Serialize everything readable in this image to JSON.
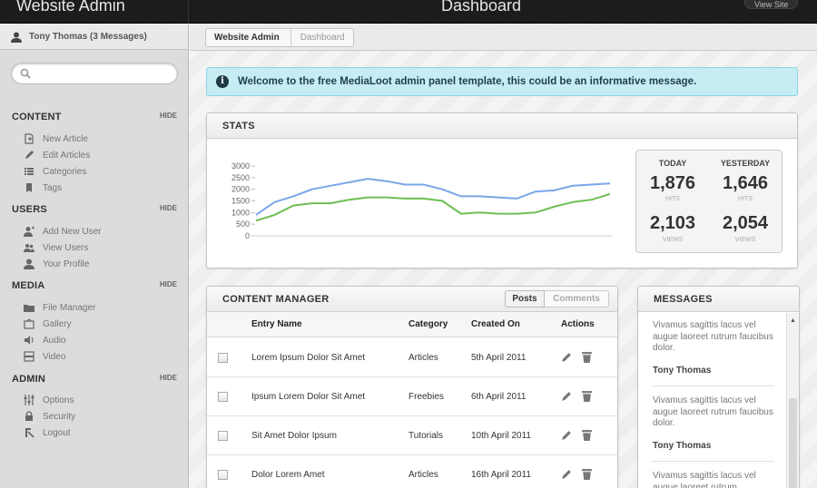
{
  "header": {
    "site_title": "Website Admin",
    "page_title": "Dashboard",
    "view_site": "View Site"
  },
  "user": {
    "label": "Tony Thomas (3 Messages)"
  },
  "search": {
    "placeholder": ""
  },
  "sidebar": {
    "hide_label": "HIDE",
    "sections": [
      {
        "title": "CONTENT",
        "items": [
          {
            "label": "New Article",
            "icon": "new-article-icon"
          },
          {
            "label": "Edit Articles",
            "icon": "pencil-icon"
          },
          {
            "label": "Categories",
            "icon": "list-icon"
          },
          {
            "label": "Tags",
            "icon": "tag-icon"
          }
        ]
      },
      {
        "title": "USERS",
        "items": [
          {
            "label": "Add New User",
            "icon": "add-user-icon"
          },
          {
            "label": "View Users",
            "icon": "users-icon"
          },
          {
            "label": "Your Profile",
            "icon": "profile-icon"
          }
        ]
      },
      {
        "title": "MEDIA",
        "items": [
          {
            "label": "File Manager",
            "icon": "folder-icon"
          },
          {
            "label": "Gallery",
            "icon": "gallery-icon"
          },
          {
            "label": "Audio",
            "icon": "audio-icon"
          },
          {
            "label": "Video",
            "icon": "video-icon"
          }
        ]
      },
      {
        "title": "ADMIN",
        "items": [
          {
            "label": "Options",
            "icon": "sliders-icon"
          },
          {
            "label": "Security",
            "icon": "lock-icon"
          },
          {
            "label": "Logout",
            "icon": "logout-icon"
          }
        ]
      }
    ]
  },
  "breadcrumb": {
    "items": [
      "Website Admin",
      "Dashboard"
    ]
  },
  "alert": {
    "text": "Welcome to the free MediaLoot admin panel template, this could be an informative message."
  },
  "stats": {
    "title": "STATS",
    "today_label": "TODAY",
    "yesterday_label": "YESTERDAY",
    "today_hits": "1,876",
    "yesterday_hits": "1,646",
    "hits_label": "HITS",
    "today_views": "2,103",
    "yesterday_views": "2,054",
    "views_label": "VIEWS"
  },
  "chart_data": {
    "type": "line",
    "x": [
      1,
      2,
      3,
      4,
      5,
      6,
      7,
      8,
      9,
      10,
      11,
      12,
      13,
      14,
      15,
      16,
      17,
      18,
      19,
      20
    ],
    "ylim": [
      0,
      3000
    ],
    "yticks": [
      0,
      500,
      1000,
      1500,
      2000,
      2500,
      3000
    ],
    "series": [
      {
        "values": [
          900,
          1450,
          1700,
          2000,
          2150,
          2300,
          2450,
          2350,
          2200,
          2200,
          2000,
          1700,
          1700,
          1650,
          1600,
          1900,
          1950,
          2150,
          2200,
          2250
        ],
        "color": "#7aa6e8"
      },
      {
        "values": [
          650,
          900,
          1300,
          1400,
          1400,
          1550,
          1650,
          1650,
          1600,
          1600,
          1500,
          950,
          1000,
          950,
          950,
          1000,
          1250,
          1450,
          1550,
          1800
        ],
        "color": "#6cbf52"
      }
    ]
  },
  "content_manager": {
    "title": "CONTENT MANAGER",
    "tabs": [
      "Posts",
      "Comments"
    ],
    "columns": [
      "Entry Name",
      "Category",
      "Created On",
      "Actions"
    ],
    "rows": [
      {
        "name": "Lorem Ipsum Dolor Sit Amet",
        "category": "Articles",
        "date": "5th April 2011"
      },
      {
        "name": "Ipsum Lorem Dolor Sit Amet",
        "category": "Freebies",
        "date": "6th April 2011"
      },
      {
        "name": "Sit Amet Dolor Ipsum",
        "category": "Tutorials",
        "date": "10th April 2011"
      },
      {
        "name": "Dolor Lorem Amet",
        "category": "Articles",
        "date": "16th April 2011"
      }
    ]
  },
  "messages": {
    "title": "MESSAGES",
    "items": [
      {
        "text": "Vivamus sagittis lacus vel augue laoreet rutrum faucibus dolor.",
        "author": "Tony Thomas"
      },
      {
        "text": "Vivamus sagittis lacus vel augue laoreet rutrum faucibus dolor.",
        "author": "Tony Thomas"
      },
      {
        "text": "Vivamus sagittis lacus vel augue laoreet rutrum",
        "author": ""
      }
    ]
  }
}
